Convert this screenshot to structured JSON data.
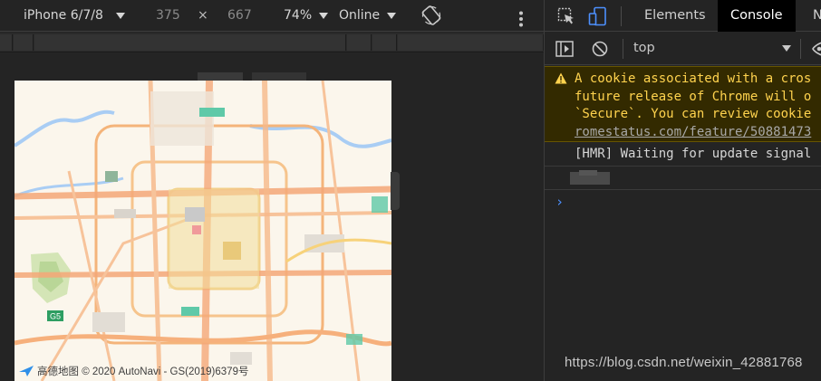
{
  "device_toolbar": {
    "device": "iPhone 6/7/8",
    "width": "375",
    "times": "×",
    "height": "667",
    "zoom": "74%",
    "network": "Online"
  },
  "map": {
    "attribution": "高德地图 © 2020 AutoNavi - GS(2019)6379号",
    "road_shield": "G5"
  },
  "devtools": {
    "tabs": [
      "Elements",
      "Console",
      "N"
    ],
    "active_tab": "Console",
    "context": "top",
    "warning_lines": [
      "A cookie associated with a cros",
      "future release of Chrome will o",
      "`Secure`. You can review cookie"
    ],
    "warning_link": "romestatus.com/feature/50881473",
    "hmr_message": "[HMR] Waiting for update signal",
    "prompt_symbol": "›"
  },
  "watermark": "https://blog.csdn.net/weixin_42881768",
  "colors": {
    "accent_blue": "#4d90fe",
    "warning_text": "#ffd34e",
    "warning_bg": "#332a00"
  },
  "icons": [
    "chevron-down-icon",
    "rotate-icon",
    "more-vertical-icon",
    "inspect-icon",
    "device-toggle-icon",
    "sidebar-toggle-icon",
    "clear-console-icon",
    "warning-icon"
  ]
}
